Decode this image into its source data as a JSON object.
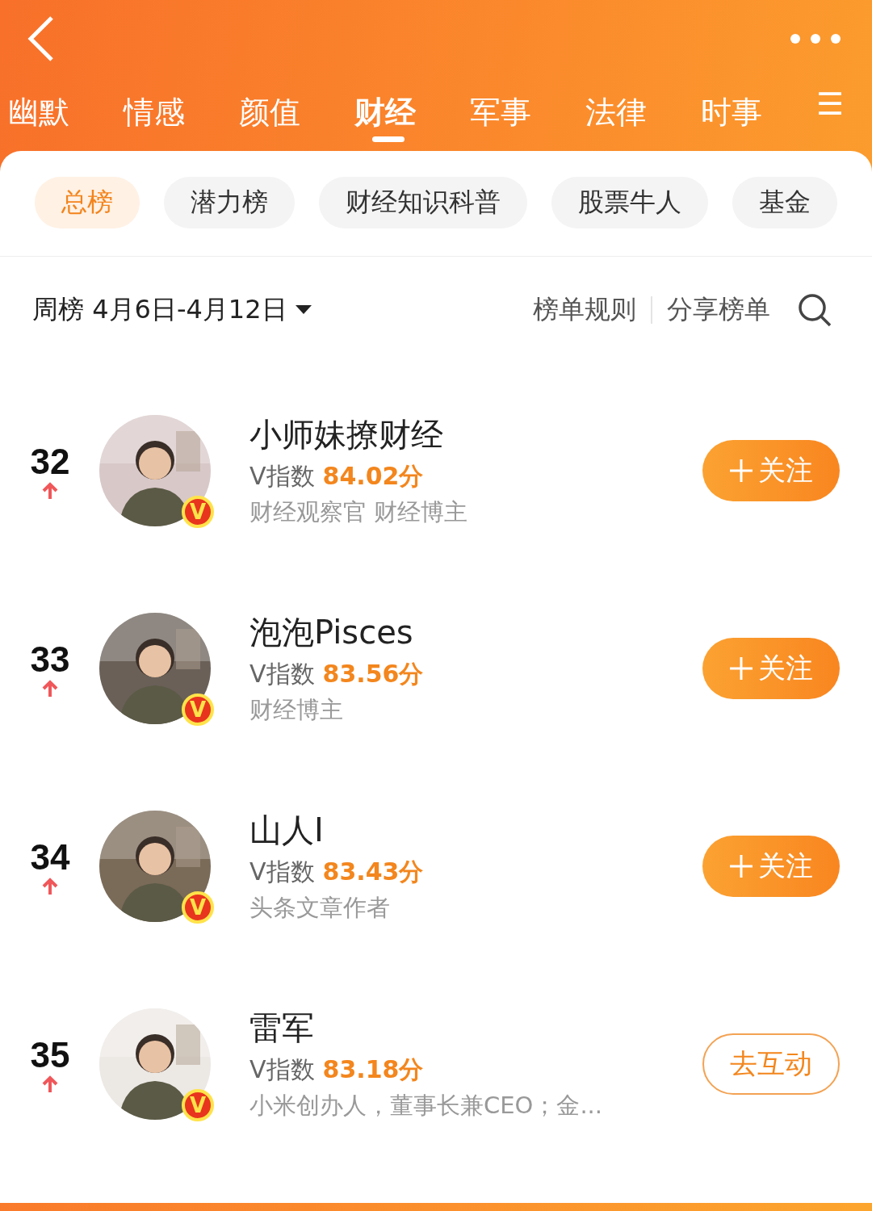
{
  "categories": [
    {
      "label": "幽默",
      "selected": false
    },
    {
      "label": "情感",
      "selected": false
    },
    {
      "label": "颜值",
      "selected": false
    },
    {
      "label": "财经",
      "selected": true
    },
    {
      "label": "军事",
      "selected": false
    },
    {
      "label": "法律",
      "selected": false
    },
    {
      "label": "时事",
      "selected": false
    }
  ],
  "menu_glyph": "☰",
  "subtabs": [
    {
      "label": "总榜",
      "selected": true
    },
    {
      "label": "潜力榜",
      "selected": false
    },
    {
      "label": "财经知识科普",
      "selected": false
    },
    {
      "label": "股票牛人",
      "selected": false
    },
    {
      "label": "基金",
      "selected": false
    }
  ],
  "period": {
    "label": "周榜",
    "range": "4月6日-4月12日"
  },
  "links": [
    "榜单规则",
    "分享榜单"
  ],
  "rows": [
    {
      "rank": "32",
      "rising": true,
      "name": "小师妹撩财经",
      "score_label": "V指数",
      "score": "84.02分",
      "description": "财经观察官 财经博主",
      "badge": "V",
      "button": {
        "kind": "follow",
        "label": "关注"
      }
    },
    {
      "rank": "33",
      "rising": true,
      "name": "泡泡Pisces",
      "score_label": "V指数",
      "score": "83.56分",
      "description": "财经博主",
      "badge": "V",
      "button": {
        "kind": "follow",
        "label": "关注"
      }
    },
    {
      "rank": "34",
      "rising": true,
      "name": "山人I",
      "score_label": "V指数",
      "score": "83.43分",
      "description": "头条文章作者",
      "badge": "V",
      "button": {
        "kind": "follow",
        "label": "关注"
      }
    },
    {
      "rank": "35",
      "rising": true,
      "name": "雷军",
      "score_label": "V指数",
      "score": "83.18分",
      "description": "小米创办人，董事长兼CEO；金...",
      "badge": "V",
      "button": {
        "kind": "interact",
        "label": "去互动"
      }
    }
  ]
}
